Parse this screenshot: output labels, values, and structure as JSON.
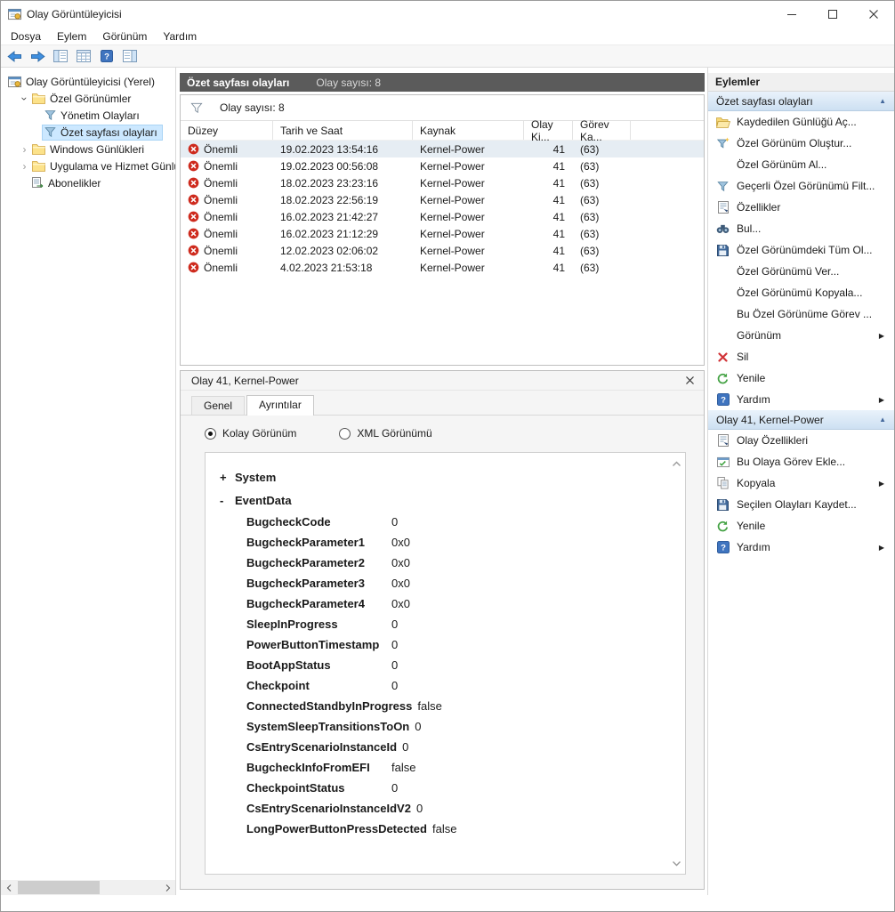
{
  "window": {
    "title": "Olay Görüntüleyicisi"
  },
  "menu": [
    {
      "label": "Dosya"
    },
    {
      "label": "Eylem"
    },
    {
      "label": "Görünüm"
    },
    {
      "label": "Yardım"
    }
  ],
  "toolbar": {
    "buttons": [
      {
        "name": "back",
        "icon": "back"
      },
      {
        "name": "forward",
        "icon": "forward"
      },
      {
        "name": "show-console-tree",
        "icon": "tree"
      },
      {
        "name": "export-list",
        "icon": "grid"
      },
      {
        "name": "help",
        "icon": "help"
      },
      {
        "name": "show-action-pane",
        "icon": "actionpane"
      }
    ]
  },
  "colors": {
    "critical_red": "#ce2a1d",
    "results_header_bg": "#5b5b5b",
    "tree_selection_blue": "#cce8ff",
    "action_header_blue": "#cde0f2"
  },
  "tree": {
    "items": [
      {
        "label": "Olay Görüntüleyicisi (Yerel)",
        "icon": "app",
        "level": 0,
        "expander": "none",
        "selected": false
      },
      {
        "label": "Özel Görünümler",
        "icon": "folder",
        "level": 1,
        "expander": "expanded",
        "selected": false
      },
      {
        "label": "Yönetim Olayları",
        "icon": "filter",
        "level": 2,
        "expander": "none",
        "selected": false
      },
      {
        "label": "Özet sayfası olayları",
        "icon": "filter",
        "level": 2,
        "expander": "none",
        "selected": true
      },
      {
        "label": "Windows Günlükleri",
        "icon": "folder",
        "level": 1,
        "expander": "collapsed",
        "selected": false
      },
      {
        "label": "Uygulama ve Hizmet Günlük",
        "icon": "folder",
        "level": 1,
        "expander": "collapsed",
        "selected": false
      },
      {
        "label": "Abonelikler",
        "icon": "subs",
        "level": 1,
        "expander": "none",
        "selected": false
      }
    ]
  },
  "results": {
    "header_title": "Özet sayfası olayları",
    "header_subtitle": "Olay sayısı: 8",
    "filter_text": "Olay sayısı: 8",
    "columns": [
      "Düzey",
      "Tarih ve Saat",
      "Kaynak",
      "Olay Ki...",
      "Görev Ka..."
    ],
    "rows": [
      {
        "level": "Önemli",
        "datetime": "19.02.2023 13:54:16",
        "source": "Kernel-Power",
        "event_id": "41",
        "task_category": "(63)",
        "selected": true
      },
      {
        "level": "Önemli",
        "datetime": "19.02.2023 00:56:08",
        "source": "Kernel-Power",
        "event_id": "41",
        "task_category": "(63)",
        "selected": false
      },
      {
        "level": "Önemli",
        "datetime": "18.02.2023 23:23:16",
        "source": "Kernel-Power",
        "event_id": "41",
        "task_category": "(63)",
        "selected": false
      },
      {
        "level": "Önemli",
        "datetime": "18.02.2023 22:56:19",
        "source": "Kernel-Power",
        "event_id": "41",
        "task_category": "(63)",
        "selected": false
      },
      {
        "level": "Önemli",
        "datetime": "16.02.2023 21:42:27",
        "source": "Kernel-Power",
        "event_id": "41",
        "task_category": "(63)",
        "selected": false
      },
      {
        "level": "Önemli",
        "datetime": "16.02.2023 21:12:29",
        "source": "Kernel-Power",
        "event_id": "41",
        "task_category": "(63)",
        "selected": false
      },
      {
        "level": "Önemli",
        "datetime": "12.02.2023 02:06:02",
        "source": "Kernel-Power",
        "event_id": "41",
        "task_category": "(63)",
        "selected": false
      },
      {
        "level": "Önemli",
        "datetime": "4.02.2023 21:53:18",
        "source": "Kernel-Power",
        "event_id": "41",
        "task_category": "(63)",
        "selected": false
      }
    ]
  },
  "preview": {
    "title": "Olay 41, Kernel-Power",
    "tabs": [
      {
        "label": "Genel",
        "active": false
      },
      {
        "label": "Ayrıntılar",
        "active": true
      }
    ],
    "view_modes": [
      {
        "label": "Kolay Görünüm",
        "selected": true
      },
      {
        "label": "XML Görünümü",
        "selected": false
      }
    ],
    "expander_glyphs": {
      "expanded": "-",
      "collapsed": "+"
    },
    "nodes": [
      {
        "name": "System",
        "state": "collapsed"
      },
      {
        "name": "EventData",
        "state": "expanded"
      }
    ],
    "event_data": [
      {
        "name": "BugcheckCode",
        "value": "0"
      },
      {
        "name": "BugcheckParameter1",
        "value": "0x0"
      },
      {
        "name": "BugcheckParameter2",
        "value": "0x0"
      },
      {
        "name": "BugcheckParameter3",
        "value": "0x0"
      },
      {
        "name": "BugcheckParameter4",
        "value": "0x0"
      },
      {
        "name": "SleepInProgress",
        "value": "0"
      },
      {
        "name": "PowerButtonTimestamp",
        "value": "0"
      },
      {
        "name": "BootAppStatus",
        "value": "0"
      },
      {
        "name": "Checkpoint",
        "value": "0"
      },
      {
        "name": "ConnectedStandbyInProgress",
        "value": "false"
      },
      {
        "name": "SystemSleepTransitionsToOn",
        "value": "0"
      },
      {
        "name": "CsEntryScenarioInstanceId",
        "value": "0"
      },
      {
        "name": "BugcheckInfoFromEFI",
        "value": "false"
      },
      {
        "name": "CheckpointStatus",
        "value": "0"
      },
      {
        "name": "CsEntryScenarioInstanceIdV2",
        "value": "0"
      },
      {
        "name": "LongPowerButtonPressDetected",
        "value": "false"
      }
    ]
  },
  "actions": {
    "title": "Eylemler",
    "collapse_glyph": "▲",
    "submenu_glyph": "▶",
    "groups": [
      {
        "title": "Özet sayfası olayları",
        "items": [
          {
            "label": "Kaydedilen Günlüğü Aç...",
            "icon": "openfolder",
            "submenu": false
          },
          {
            "label": "Özel Görünüm Oluştur...",
            "icon": "filternew",
            "submenu": false
          },
          {
            "label": "Özel Görünüm Al...",
            "icon": "",
            "submenu": false
          },
          {
            "label": "Geçerli Özel Görünümü Filt...",
            "icon": "filter",
            "submenu": false
          },
          {
            "label": "Özellikler",
            "icon": "props",
            "submenu": false
          },
          {
            "label": "Bul...",
            "icon": "find",
            "submenu": false
          },
          {
            "label": "Özel Görünümdeki Tüm Ol...",
            "icon": "save",
            "submenu": false
          },
          {
            "label": "Özel Görünümü Ver...",
            "icon": "",
            "submenu": false
          },
          {
            "label": "Özel Görünümü Kopyala...",
            "icon": "",
            "submenu": false
          },
          {
            "label": "Bu Özel Görünüme Görev ...",
            "icon": "",
            "submenu": false
          },
          {
            "label": "Görünüm",
            "icon": "",
            "submenu": true
          },
          {
            "label": "Sil",
            "icon": "del",
            "submenu": false
          },
          {
            "label": "Yenile",
            "icon": "refresh",
            "submenu": false
          },
          {
            "label": "Yardım",
            "icon": "help",
            "submenu": true
          }
        ]
      },
      {
        "title": "Olay 41, Kernel-Power",
        "items": [
          {
            "label": "Olay Özellikleri",
            "icon": "props",
            "submenu": false
          },
          {
            "label": "Bu Olaya Görev Ekle...",
            "icon": "task",
            "submenu": false
          },
          {
            "label": "Kopyala",
            "icon": "copy",
            "submenu": true
          },
          {
            "label": "Seçilen Olayları Kaydet...",
            "icon": "save",
            "submenu": false
          },
          {
            "label": "Yenile",
            "icon": "refresh",
            "submenu": false
          },
          {
            "label": "Yardım",
            "icon": "help",
            "submenu": true
          }
        ]
      }
    ]
  }
}
